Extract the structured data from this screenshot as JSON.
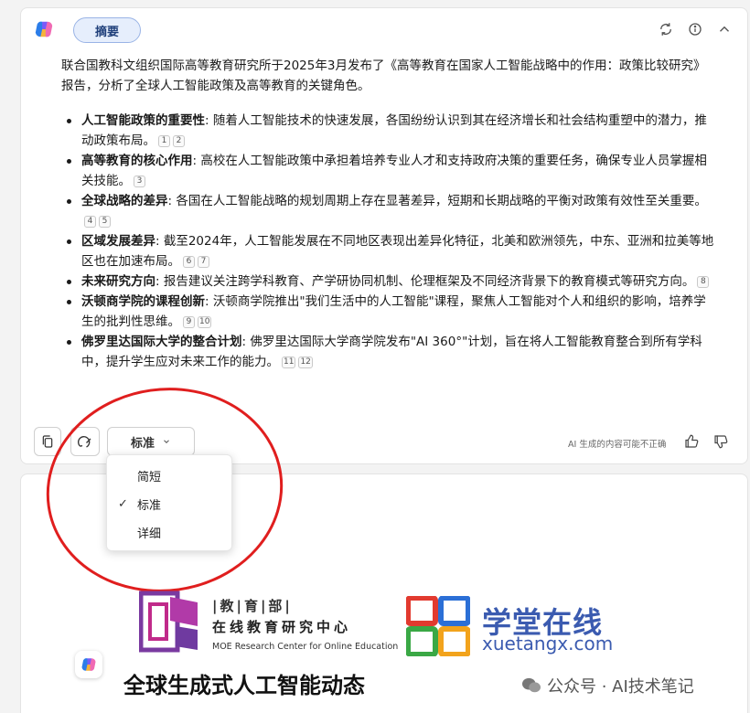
{
  "header": {
    "tag_label": "摘要"
  },
  "summary": {
    "intro": "联合国教科文组织国际高等教育研究所于2025年3月发布了《高等教育在国家人工智能战略中的作用：政策比较研究》报告，分析了全球人工智能政策及高等教育的关键角色。",
    "bullets": [
      {
        "title": "人工智能政策的重要性",
        "text": ": 随着人工智能技术的快速发展，各国纷纷认识到其在经济增长和社会结构重塑中的潜力，推动政策布局。",
        "cites": [
          "1",
          "2"
        ]
      },
      {
        "title": "高等教育的核心作用",
        "text": ": 高校在人工智能政策中承担着培养专业人才和支持政府决策的重要任务，确保专业人员掌握相关技能。",
        "cites": [
          "3"
        ]
      },
      {
        "title": "全球战略的差异",
        "text": ": 各国在人工智能战略的规划周期上存在显著差异，短期和长期战略的平衡对政策有效性至关重要。",
        "cites": [
          "4",
          "5"
        ]
      },
      {
        "title": "区域发展差异",
        "text": ": 截至2024年，人工智能发展在不同地区表现出差异化特征，北美和欧洲领先，中东、亚洲和拉美等地区也在加速布局。",
        "cites": [
          "6",
          "7"
        ]
      },
      {
        "title": "未来研究方向",
        "text": ": 报告建议关注跨学科教育、产学研协同机制、伦理框架及不同经济背景下的教育模式等研究方向。",
        "cites": [
          "8"
        ]
      },
      {
        "title": "沃顿商学院的课程创新",
        "text": ": 沃顿商学院推出\"我们生活中的人工智能\"课程，聚焦人工智能对个人和组织的影响，培养学生的批判性思维。",
        "cites": [
          "9",
          "10"
        ]
      },
      {
        "title": "佛罗里达国际大学的整合计划",
        "text": ": 佛罗里达国际大学商学院发布\"AI 360°\"计划，旨在将人工智能教育整合到所有学科中，提升学生应对未来工作的能力。",
        "cites": [
          "11",
          "12"
        ]
      }
    ]
  },
  "footer": {
    "length_button": "标准",
    "disclaimer": "AI 生成的内容可能不正确"
  },
  "length_menu": {
    "options": [
      "简短",
      "标准",
      "详细"
    ],
    "selected": "标准"
  },
  "banner": {
    "moe_top": "|教|育|部|",
    "moe_mid": "在线教育研究中心",
    "moe_en": "MOE Research Center for Online Education",
    "xt_cn": "学堂在线",
    "xt_en": "xuetangx.com",
    "title": "全球生成式人工智能动态",
    "watermark": "公众号 · AI技术笔记"
  },
  "colors": {
    "accent": "#3b5bb0",
    "annotation": "#e01e1e",
    "tag_bg": "#e6eefc"
  }
}
